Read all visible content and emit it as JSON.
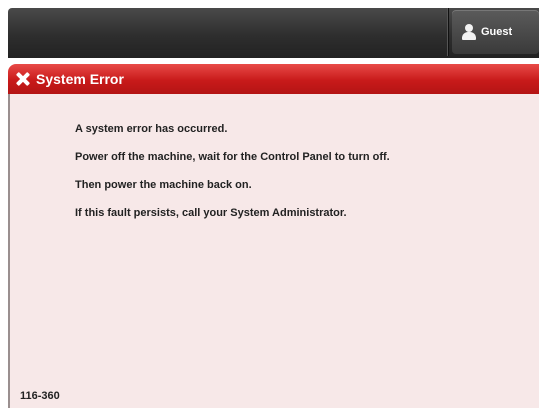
{
  "topbar": {
    "user_label": "Guest",
    "user_icon": "user-icon"
  },
  "error_dialog": {
    "title": "System Error",
    "title_icon": "close-icon",
    "header_color": "#c81a1a",
    "panel_color": "#f7e8e8",
    "messages": [
      "A system error has occurred.",
      "Power off the machine, wait for the Control Panel to turn off.",
      "Then power the machine back on.",
      "If this fault persists, call your System Administrator."
    ],
    "code": "116-360"
  }
}
